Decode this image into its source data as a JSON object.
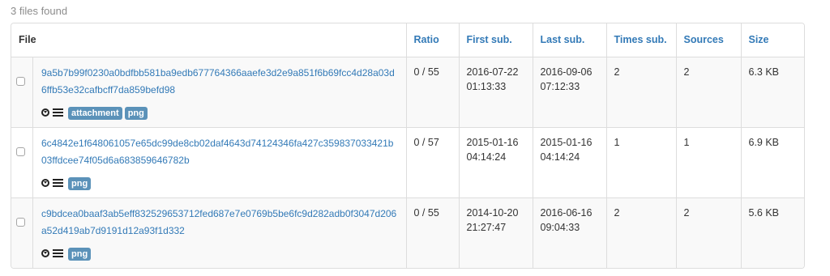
{
  "summary": {
    "files_found": "3 files found"
  },
  "table": {
    "headers": {
      "file": "File",
      "ratio": "Ratio",
      "first_sub": "First sub.",
      "last_sub": "Last sub.",
      "times_sub": "Times sub.",
      "sources": "Sources",
      "size": "Size"
    },
    "rows": [
      {
        "hash": "9a5b7b99f0230a0bdfbb581ba9edb677764366aaefe3d2e9a851f6b69fcc4d28a03d6ffb53e32cafbcff7da859befd98",
        "tags": [
          "attachment",
          "png"
        ],
        "ratio": "0 / 55",
        "first_sub": "2016-07-22 01:13:33",
        "last_sub": "2016-09-06 07:12:33",
        "times_sub": "2",
        "sources": "2",
        "size": "6.3 KB"
      },
      {
        "hash": "6c4842e1f648061057e65dc99de8cb02daf4643d74124346fa427c359837033421b03ffdcee74f05d6a683859646782b",
        "tags": [
          "png"
        ],
        "ratio": "0 / 57",
        "first_sub": "2015-01-16 04:14:24",
        "last_sub": "2015-01-16 04:14:24",
        "times_sub": "1",
        "sources": "1",
        "size": "6.9 KB"
      },
      {
        "hash": "c9bdcea0baaf3ab5eff832529653712fed687e7e0769b5be6fc9d282adb0f3047d206a52d419ab7d9191d12a93f1d332",
        "tags": [
          "png"
        ],
        "ratio": "0 / 55",
        "first_sub": "2014-10-20 21:27:47",
        "last_sub": "2016-06-16 09:04:33",
        "times_sub": "2",
        "sources": "2",
        "size": "5.6 KB"
      }
    ]
  },
  "icons": {
    "download": "download-icon",
    "details": "list-icon"
  },
  "colors": {
    "link": "#337ab7",
    "tag_bg": "#5b92b9",
    "border": "#dddddd",
    "stripe": "#f9f9f9"
  }
}
